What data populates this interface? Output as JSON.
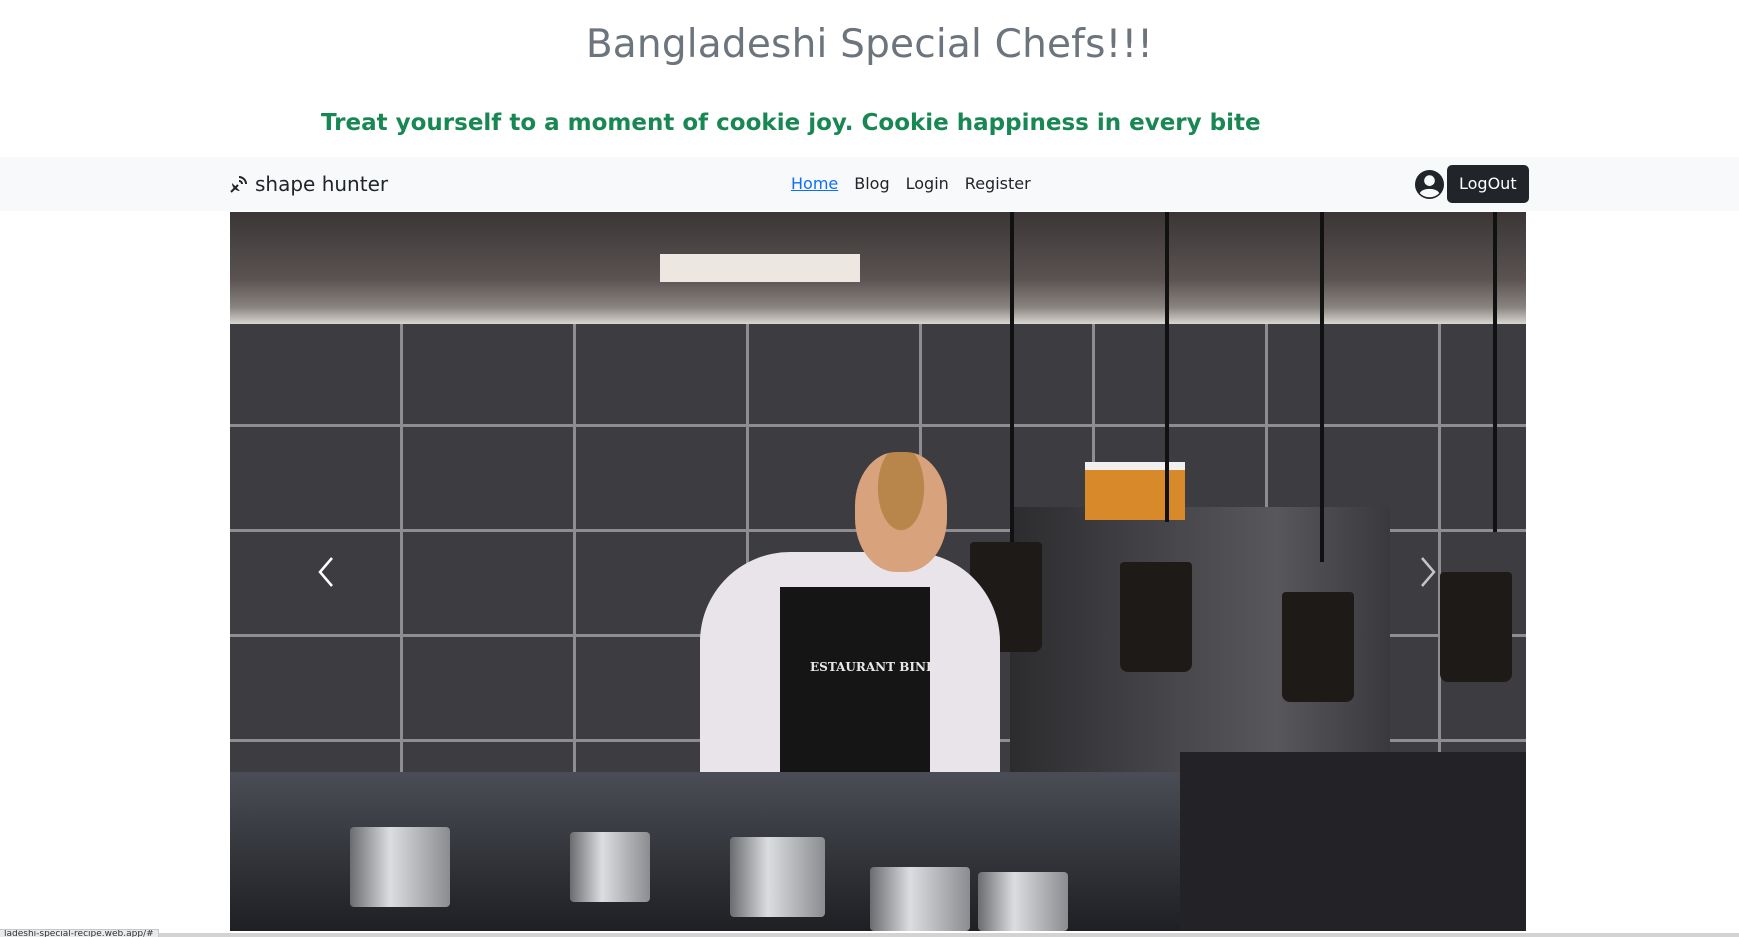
{
  "header": {
    "title": "Bangladeshi Special Chefs!!!",
    "tagline": "Treat yourself to a moment of cookie joy. Cookie happiness in every bite"
  },
  "navbar": {
    "brand": "shape hunter",
    "brand_icon": "satellite-dish-icon",
    "links": [
      {
        "label": "Home",
        "active": true
      },
      {
        "label": "Blog",
        "active": false
      },
      {
        "label": "Login",
        "active": false
      },
      {
        "label": "Register",
        "active": false
      }
    ],
    "user_icon": "user-circle-icon",
    "logout_label": "LogOut"
  },
  "carousel": {
    "slide_apron_text": "ESTAURANT BIND",
    "prev_icon": "chevron-left-icon",
    "next_icon": "chevron-right-icon"
  },
  "statusbar": {
    "url": "ladeshi-special-recipe.web.app/#"
  },
  "colors": {
    "title": "#6c757d",
    "tagline": "#198754",
    "navbar_bg": "#f8f9fa",
    "active_link": "#0d6efd",
    "logout_bg": "#212529"
  }
}
